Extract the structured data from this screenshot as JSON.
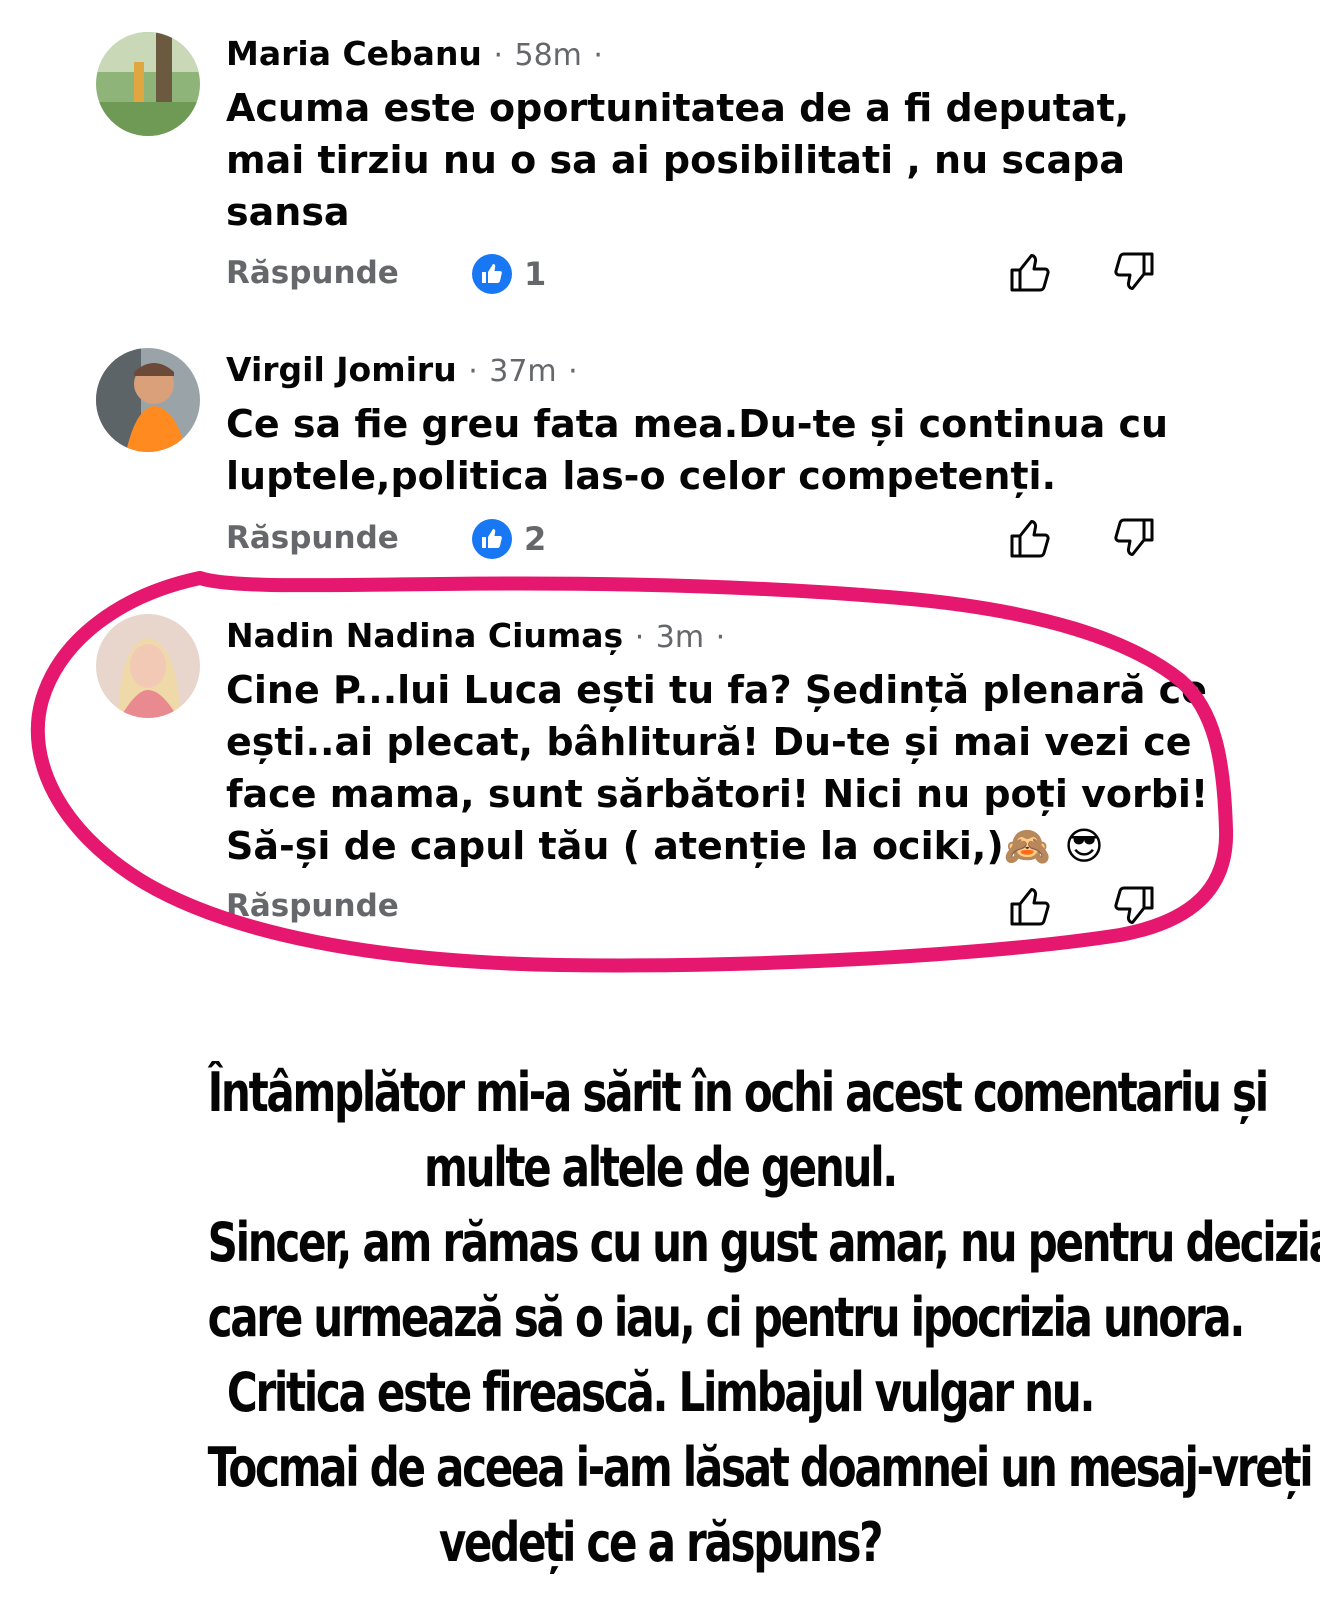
{
  "comments": [
    {
      "author": "Maria Cebanu",
      "time": "58m",
      "lines": [
        "Acuma este oportunitatea de a fi deputat,",
        "mai tirziu nu o sa ai posibilitati , nu scapa",
        "sansa"
      ],
      "reply_label": "Răspunde",
      "likes": "1",
      "avatar_icon": "park-photo"
    },
    {
      "author": "Virgil Jomiru",
      "time": "37m",
      "lines": [
        "Ce sa fie greu fata mea.Du-te și continua cu",
        "luptele,politica las-o celor competenți."
      ],
      "reply_label": "Răspunde",
      "likes": "2",
      "avatar_icon": "man-in-car-photo"
    },
    {
      "author": "Nadin Nadina Ciumaș",
      "time": "3m",
      "lines": [
        "Cine P...lui Luca ești tu fa? Ședință plenară ce",
        "ești..ai plecat, bâhlitură! Du-te și mai vezi ce",
        "face mama, sunt sărbători! Nici nu poți vorbi!",
        "Să-și de capul tău ( atenție la ociki,)"
      ],
      "emoji": [
        "🙈",
        "😎"
      ],
      "reply_label": "Răspunde",
      "avatar_icon": "woman-portrait-photo"
    }
  ],
  "separator": "·",
  "caption": [
    "Întâmplător mi-a sărit în ochi acest comentariu și",
    "multe altele de genul.",
    "Sincer, am rămas cu un gust amar, nu pentru decizia",
    "care urmează să o iau, ci pentru ipocrizia unora.",
    "Critica este firească. Limbajul vulgar nu.",
    "Tocmai de aceea i-am lăsat doamnei un mesaj-vreți să",
    "vedeți ce a răspuns?"
  ],
  "colors": {
    "highlight": "#e5176e",
    "like_blue": "#1877f2",
    "meta_gray": "#65676b"
  }
}
